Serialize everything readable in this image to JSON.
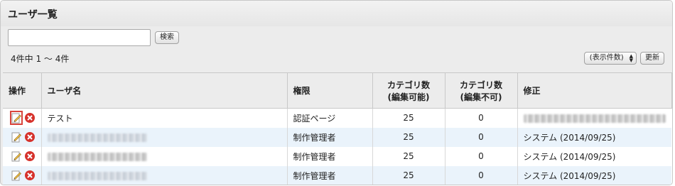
{
  "page": {
    "title": "ユーザ一覧",
    "search": {
      "value": "",
      "placeholder": "",
      "button_label": "検索"
    },
    "count_text": "4件中 1 〜 4件",
    "per_page_label": "(表示件数)",
    "update_label": "更新"
  },
  "table": {
    "headers": {
      "ops": "操作",
      "username": "ユーザ名",
      "role": "権限",
      "cat_edit": "カテゴリ数\n(編集可能)",
      "cat_noedit": "カテゴリ数\n(編集不可)",
      "modified": "修正"
    },
    "rows": [
      {
        "username": "テスト",
        "role": "認証ページ",
        "cat_edit": "25",
        "cat_noedit": "0",
        "modified": ""
      },
      {
        "username": "",
        "role": "制作管理者",
        "cat_edit": "25",
        "cat_noedit": "0",
        "modified": "システム (2014/09/25)"
      },
      {
        "username": "",
        "role": "制作管理者",
        "cat_edit": "25",
        "cat_noedit": "0",
        "modified": "システム (2014/09/25)"
      },
      {
        "username": "",
        "role": "制作管理者",
        "cat_edit": "25",
        "cat_noedit": "0",
        "modified": "システム (2014/09/25)"
      }
    ]
  },
  "colors": {
    "accent_red": "#d9453d",
    "row_alt": "#eaf3fb"
  },
  "icons": {
    "edit": "edit-pencil-icon",
    "delete": "delete-x-icon"
  }
}
